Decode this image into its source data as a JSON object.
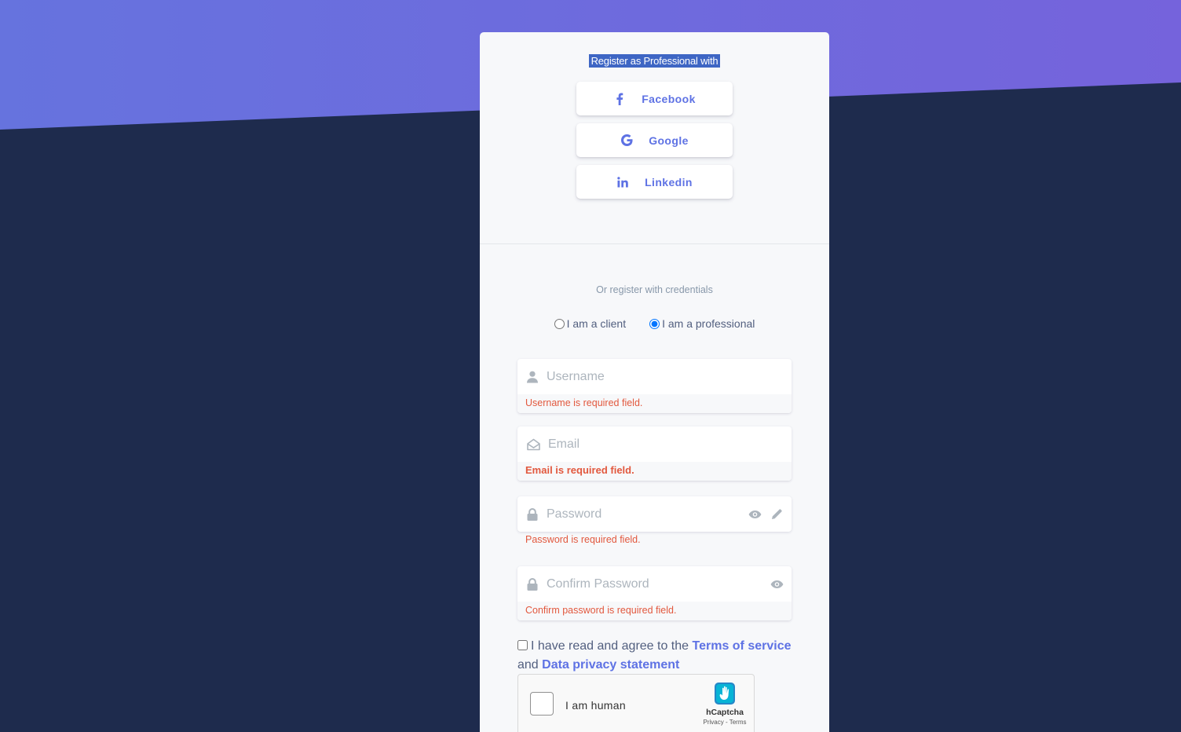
{
  "social": {
    "title": "Register as Professional with",
    "buttons": [
      {
        "label": "Facebook",
        "icon": "facebook-icon"
      },
      {
        "label": "Google",
        "icon": "google-icon"
      },
      {
        "label": "Linkedin",
        "icon": "linkedin-icon"
      }
    ]
  },
  "credentials": {
    "or_text": "Or register with credentials",
    "role_options": [
      {
        "label": "I am a client",
        "selected": false
      },
      {
        "label": "I am a professional",
        "selected": true
      }
    ]
  },
  "fields": {
    "username": {
      "placeholder": "Username",
      "value": "",
      "error": "Username is required field."
    },
    "email": {
      "placeholder": "Email",
      "value": "",
      "error": "Email is required field."
    },
    "password": {
      "placeholder": "Password",
      "value": "",
      "error": "Password is required field."
    },
    "confirm_password": {
      "placeholder": "Confirm Password",
      "value": "",
      "error": "Confirm password is required field."
    }
  },
  "terms": {
    "prefix": "I have read and agree to the",
    "tos_link": "Terms of service",
    "and_text": "and",
    "privacy_link": "Data privacy statement",
    "checked": false
  },
  "captcha": {
    "label": "I am human",
    "brand": "hCaptcha",
    "links": "Privacy - Terms"
  },
  "colors": {
    "accent": "#5e72e4",
    "error": "#e2583e",
    "background_dark": "#1e2b4d",
    "selection": "#3e66c4"
  }
}
